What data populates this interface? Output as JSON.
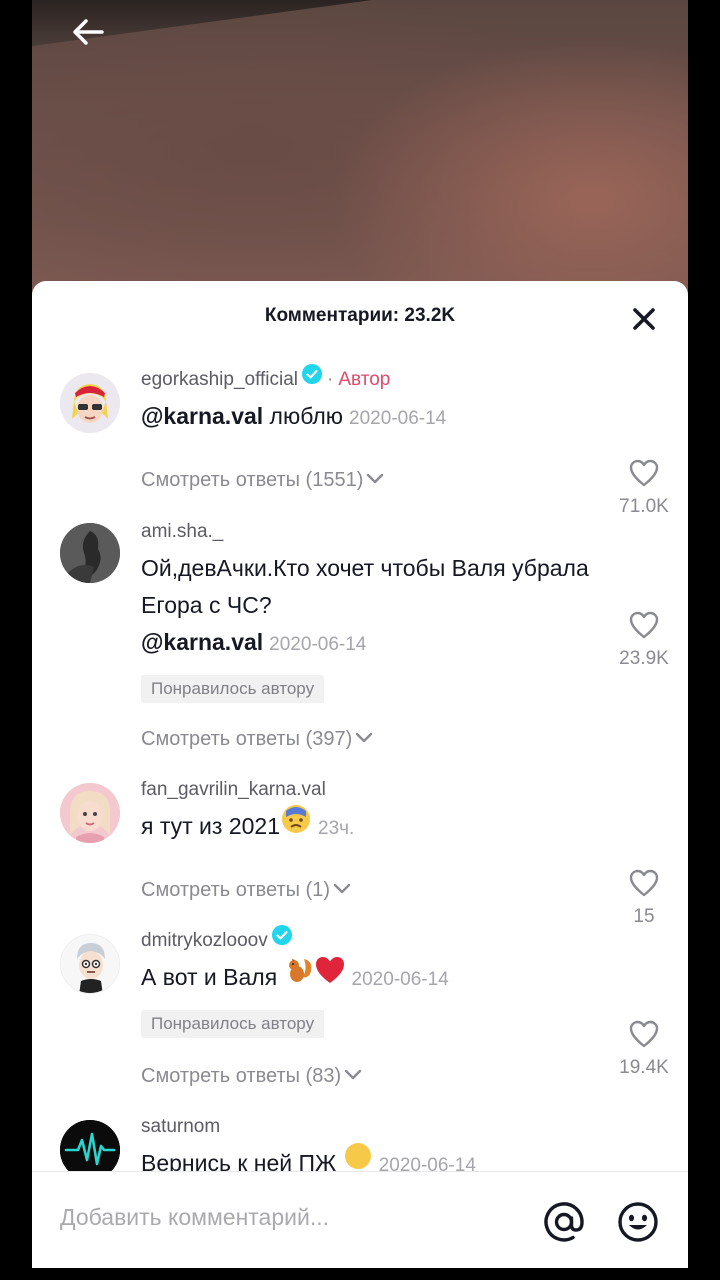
{
  "sheet": {
    "title": "Комментарии: 23.2K"
  },
  "comments": [
    {
      "username": "egorkaship_official",
      "author_tag": "Автор",
      "mention": "@karna.val",
      "text": " люблю",
      "date": "2020-06-14",
      "likes": "71.0K",
      "replies": "Смотреть ответы (1551)"
    },
    {
      "username": "ami.sha._",
      "text": "Ой,девАчки.Кто хочет чтобы Валя убрала Егора с ЧС?",
      "mention": "@karna.val",
      "date": "2020-06-14",
      "liked_by_author": "Понравилось автору",
      "likes": "23.9K",
      "replies": "Смотреть ответы (397)"
    },
    {
      "username": "fan_gavrilin_karna.val",
      "text": "я тут из 2021",
      "date": "23ч.",
      "likes": "15",
      "replies": "Смотреть ответы (1)"
    },
    {
      "username": "dmitrykozlooov",
      "text": "А вот и Валя",
      "date": "2020-06-14",
      "liked_by_author": "Понравилось автору",
      "likes": "19.4K",
      "replies": "Смотреть ответы (83)"
    },
    {
      "username": "saturnom",
      "text": "Вернись к ней ПЖ",
      "date": "2020-06-14"
    }
  ],
  "input": {
    "placeholder": "Добавить комментарий..."
  },
  "icons": {
    "back": "arrow-left-icon",
    "close": "close-icon",
    "verified": "verified-badge-icon",
    "like": "heart-icon",
    "mention": "at-icon",
    "emoji": "emoji-icon"
  },
  "colors": {
    "accent": "#e14a6a",
    "verified": "#20d5ec",
    "text": "#161823",
    "muted": "#8a8b91"
  }
}
